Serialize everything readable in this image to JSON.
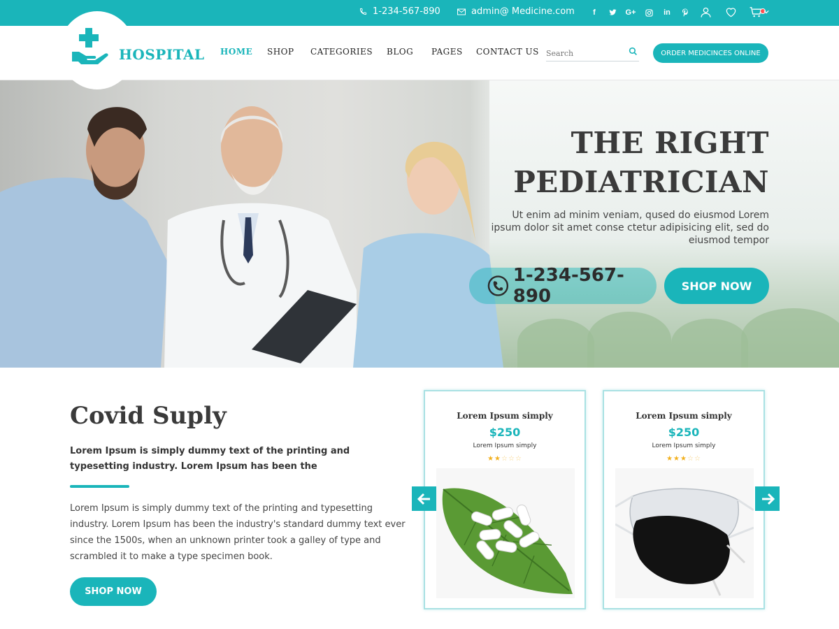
{
  "topbar": {
    "phone": "1-234-567-890",
    "email": "admin@ Medicine.com",
    "socials": [
      "f",
      "t",
      "G+",
      "ig",
      "in",
      "p"
    ]
  },
  "header": {
    "logo_text": "HOSPITAL",
    "nav": [
      "HOME",
      "SHOP",
      "CATEGORIES",
      "BLOG",
      "PAGES",
      "CONTACT US"
    ],
    "active_nav": "HOME",
    "search_placeholder": "Search",
    "order_button": "ORDER MEDICINCES ONLINE"
  },
  "hero": {
    "title_line1": "THE RIGHT",
    "title_line2": "PEDIATRICIAN",
    "subtitle": "Ut enim ad minim veniam, qused do eiusmod  Lorem ipsum dolor sit amet conse ctetur adipisicing elit, sed do eiusmod tempor",
    "phone": "1-234-567-890",
    "shop_button": "SHOP NOW"
  },
  "covid": {
    "title": "Covid Suply",
    "lead": "Lorem Ipsum is simply dummy text of the printing and typesetting industry. Lorem Ipsum has been the",
    "body": "Lorem Ipsum is simply dummy text of the printing and typesetting industry. Lorem Ipsum has been the industry's standard dummy text ever since the 1500s, when an unknown printer took a galley of type and scrambled it to make a type specimen book.",
    "shop_button": "SHOP NOW"
  },
  "products": [
    {
      "title": "Lorem Ipsum simply",
      "price": "$250",
      "subtitle": "Lorem Ipsum simply",
      "rating": 2,
      "max_rating": 5
    },
    {
      "title": "Lorem Ipsum simply",
      "price": "$250",
      "subtitle": "Lorem Ipsum simply",
      "rating": 3,
      "max_rating": 5
    }
  ],
  "colors": {
    "accent": "#1ab5ba",
    "text_dark": "#3a3a3a",
    "star": "#f2b01e"
  }
}
